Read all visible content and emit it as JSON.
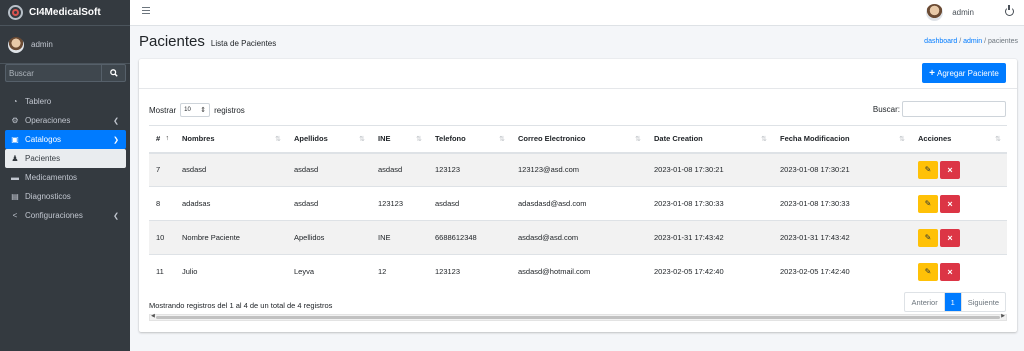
{
  "sidebar": {
    "brand": "CI4MedicalSoft",
    "user": "admin",
    "search_placeholder": "Buscar",
    "items": [
      {
        "label": "Tablero",
        "icon": "dashboard-icon"
      },
      {
        "label": "Operaciones",
        "icon": "users-cog-icon"
      },
      {
        "label": "Catalogos",
        "icon": "book-icon"
      },
      {
        "label": "Pacientes",
        "icon": "person-icon"
      },
      {
        "label": "Medicamentos",
        "icon": "truck-icon"
      },
      {
        "label": "Diagnosticos",
        "icon": "file-icon"
      },
      {
        "label": "Configuraciones",
        "icon": "share-icon"
      }
    ]
  },
  "topbar": {
    "user": "admin"
  },
  "header": {
    "title": "Pacientes",
    "subtitle": "Lista de Pacientes",
    "breadcrumb": [
      "dashboard",
      "admin",
      "pacientes"
    ]
  },
  "toolbar": {
    "add_label": "Agregar Paciente"
  },
  "table_controls": {
    "show_label": "Mostrar",
    "show_value": "10",
    "records_label": "registros",
    "search_label": "Buscar:"
  },
  "table": {
    "headers": [
      "#",
      "Nombres",
      "Apellidos",
      "INE",
      "Telefono",
      "Correo Electronico",
      "Date Creation",
      "Fecha Modificacion",
      "Acciones"
    ],
    "rows": [
      [
        "7",
        "asdasd",
        "asdasd",
        "asdasd",
        "123123",
        "123123@asd.com",
        "2023-01-08 17:30:21",
        "2023-01-08 17:30:21"
      ],
      [
        "8",
        "adadsas",
        "asdasd",
        "123123",
        "asdasd",
        "adasdasd@asd.com",
        "2023-01-08 17:30:33",
        "2023-01-08 17:30:33"
      ],
      [
        "10",
        "Nombre Paciente",
        "Apellidos",
        "INE",
        "6688612348",
        "asdasd@asd.com",
        "2023-01-31 17:43:42",
        "2023-01-31 17:43:42"
      ],
      [
        "11",
        "Julio",
        "Leyva",
        "12",
        "123123",
        "asdasd@hotmail.com",
        "2023-02-05 17:42:40",
        "2023-02-05 17:42:40"
      ]
    ]
  },
  "footer": {
    "info": "Mostrando registros del 1 al 4 de un total de 4 registros",
    "prev": "Anterior",
    "page": "1",
    "next": "Siguiente"
  }
}
